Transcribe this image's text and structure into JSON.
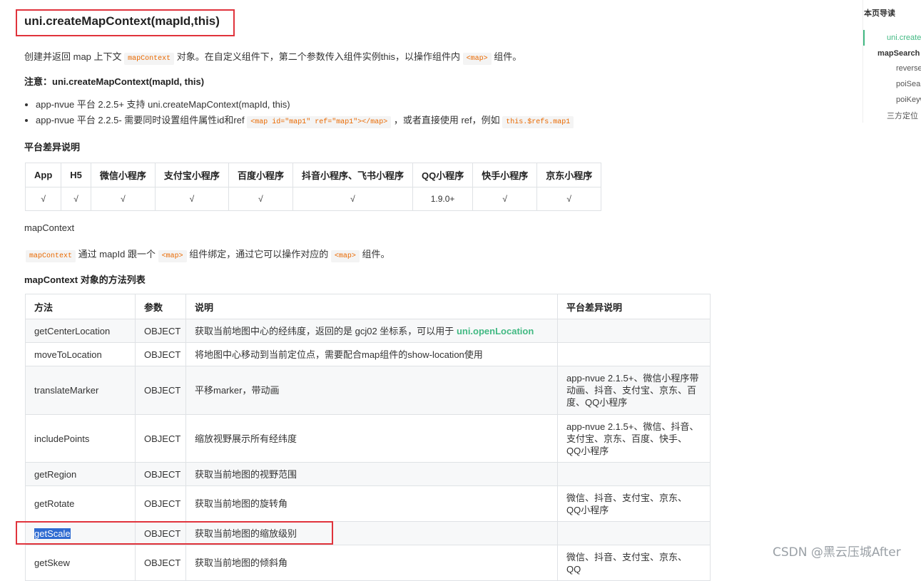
{
  "title": "uni.createMapContext(mapId,this)",
  "intro": {
    "prefix": "创建并返回 map 上下文",
    "code1": "mapContext",
    "middle": "对象。在自定义组件下，第二个参数传入组件实例this，以操作组件内",
    "code2": "<map>",
    "suffix": "组件。"
  },
  "note": {
    "label": "注意：",
    "text": "uni.createMapContext(mapId, this)"
  },
  "bullets": {
    "b1": "app-nvue 平台 2.2.5+ 支持 uni.createMapContext(mapId, this)",
    "b2_prefix": "app-nvue 平台 2.2.5- 需要同时设置组件属性id和ref",
    "b2_code": "<map id=\"map1\" ref=\"map1\"></map>",
    "b2_middle": "，或者直接使用 ref，例如",
    "b2_code2": "this.$refs.map1"
  },
  "platform_heading": "平台差异说明",
  "platform_table": {
    "headers": [
      "App",
      "H5",
      "微信小程序",
      "支付宝小程序",
      "百度小程序",
      "抖音小程序、飞书小程序",
      "QQ小程序",
      "快手小程序",
      "京东小程序"
    ],
    "values": [
      "√",
      "√",
      "√",
      "√",
      "√",
      "√",
      "1.9.0+",
      "√",
      "√"
    ]
  },
  "mapcontext_label": "mapContext",
  "mapcontext_desc": {
    "code1": "mapContext",
    "text1": "通过 mapId 跟一个",
    "code2": "<map>",
    "text2": "组件绑定，通过它可以操作对应的",
    "code3": "<map>",
    "text3": "组件。"
  },
  "methods_heading": "mapContext 对象的方法列表",
  "methods_table": {
    "headers": [
      "方法",
      "参数",
      "说明",
      "平台差异说明"
    ],
    "rows": [
      {
        "method": "getCenterLocation",
        "param": "OBJECT",
        "desc": "获取当前地图中心的经纬度，返回的是 gcj02 坐标系，可以用于",
        "desc_link": "uni.openLocation",
        "platform": ""
      },
      {
        "method": "moveToLocation",
        "param": "OBJECT",
        "desc": "将地图中心移动到当前定位点，需要配合map组件的show-location使用",
        "platform": ""
      },
      {
        "method": "translateMarker",
        "param": "OBJECT",
        "desc": "平移marker，带动画",
        "platform": "app-nvue 2.1.5+、微信小程序带动画、抖音、支付宝、京东、百度、QQ小程序"
      },
      {
        "method": "includePoints",
        "param": "OBJECT",
        "desc": "缩放视野展示所有经纬度",
        "platform": "app-nvue 2.1.5+、微信、抖音、支付宝、京东、百度、快手、QQ小程序"
      },
      {
        "method": "getRegion",
        "param": "OBJECT",
        "desc": "获取当前地图的视野范围",
        "platform": ""
      },
      {
        "method": "getRotate",
        "param": "OBJECT",
        "desc": "获取当前地图的旋转角",
        "platform": "微信、抖音、支付宝、京东、QQ小程序"
      },
      {
        "method": "getScale",
        "param": "OBJECT",
        "desc": "获取当前地图的缩放级别",
        "platform": ""
      },
      {
        "method": "getSkew",
        "param": "OBJECT",
        "desc": "获取当前地图的倾斜角",
        "platform": "微信、抖音、支付宝、京东、QQ"
      }
    ]
  },
  "toc": {
    "title": "本页导读",
    "items": [
      "uni.create",
      "mapSearch",
      "reverse",
      "poiSear",
      "poiKeyw",
      "三方定位"
    ]
  },
  "watermark": "CSDN @黑云压城After",
  "colors": {
    "accent": "#42b983",
    "highlight_box": "#e0333c",
    "code_text": "#e96900"
  }
}
